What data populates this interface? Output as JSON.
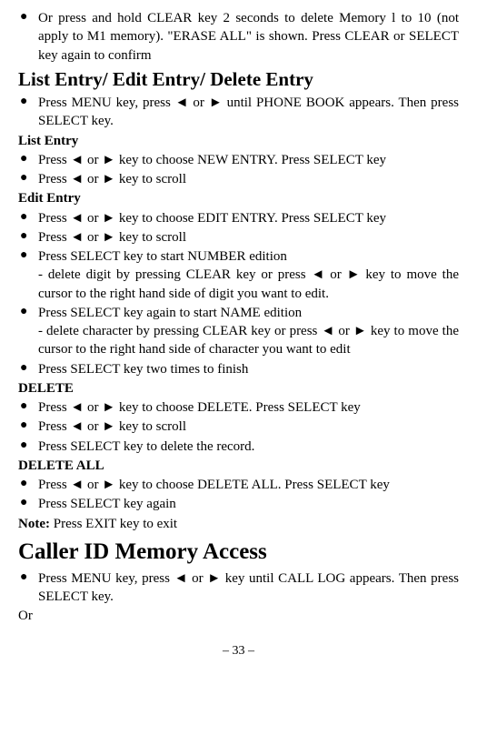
{
  "intro_bullet": "Or press and hold CLEAR key 2 seconds to delete Memory l to 10 (not apply to M1 memory). \"ERASE ALL\" is shown. Press CLEAR or SELECT key again to confirm",
  "h_list_edit_delete": "List Entry/ Edit Entry/ Delete Entry",
  "b_menu_phonebook": "Press MENU key, press ◄ or ► until PHONE BOOK appears. Then press SELECT key.",
  "h_list_entry": "List Entry",
  "b_list_new": "Press ◄ or ► key to choose NEW ENTRY. Press SELECT key",
  "b_list_scroll": "Press ◄ or ► key to scroll",
  "h_edit_entry": "Edit Entry",
  "b_edit_choose": "Press ◄ or ► key to choose EDIT ENTRY. Press SELECT key",
  "b_edit_scroll": "Press ◄ or ► key to scroll",
  "b_edit_number": "Press SELECT key to start NUMBER edition",
  "b_edit_number_sub": "- delete digit by pressing CLEAR key or press ◄ or ► key to move the cursor to the right hand side of digit you want to edit.",
  "b_edit_name": "Press SELECT key again to start NAME edition",
  "b_edit_name_sub": "- delete character by pressing CLEAR key or press ◄ or ► key to move the cursor to the right hand side of character you want to edit",
  "b_edit_finish": "Press SELECT key two times to finish",
  "h_delete": "DELETE",
  "b_del_choose": "Press ◄ or ► key to choose DELETE. Press SELECT key",
  "b_del_scroll": "Press ◄ or ► key to scroll",
  "b_del_record": "Press SELECT key to delete the record.",
  "h_delete_all": "DELETE ALL",
  "b_delall_choose": "Press ◄ or ► key to choose DELETE ALL. Press SELECT key",
  "b_delall_again": "Press SELECT key again",
  "note_label": "Note:",
  "note_text": " Press EXIT key to exit",
  "h_caller": "Caller ID Memory Access",
  "b_caller_menu": "Press MENU key, press ◄ or ► key until CALL LOG appears. Then press SELECT key.",
  "or_text": "Or",
  "page_num": "– 33 –"
}
